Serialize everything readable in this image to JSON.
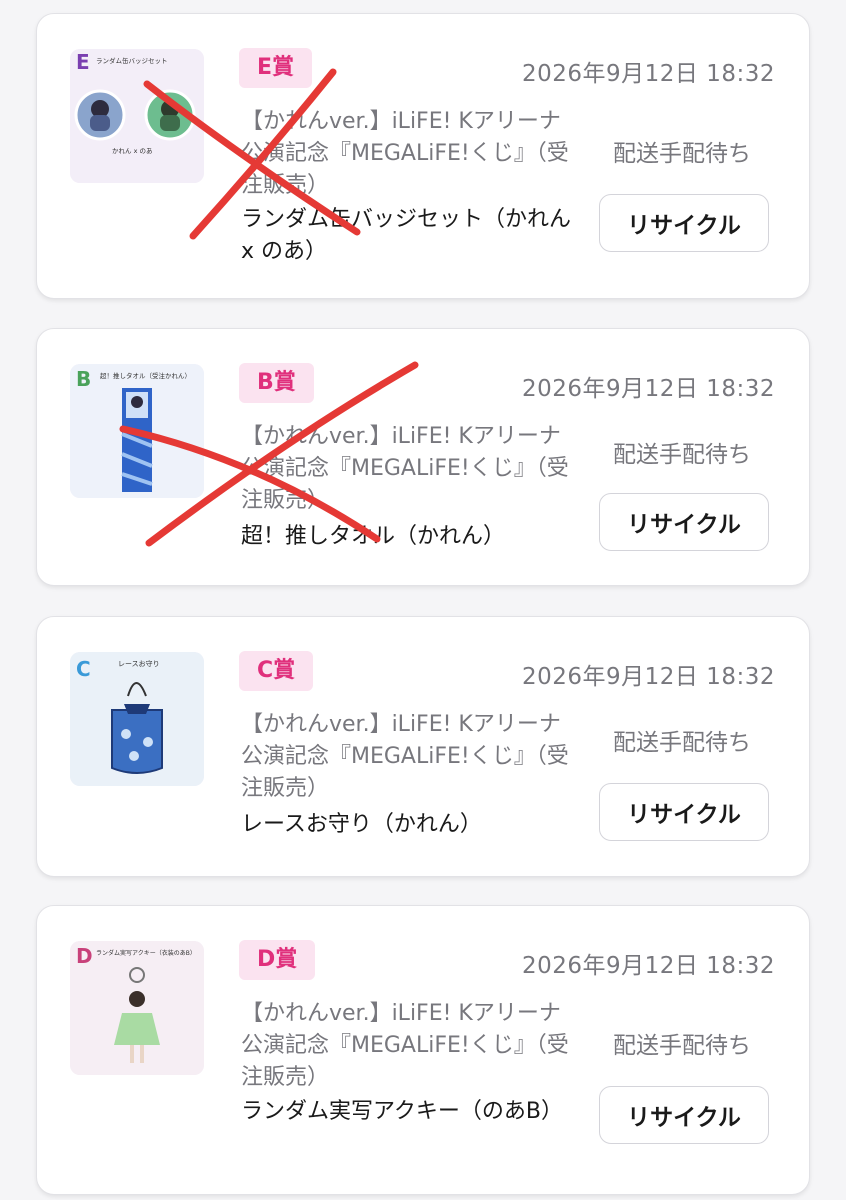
{
  "orders": [
    {
      "prize": "E賞",
      "date": "2026年9月12日 18:32",
      "description": "【かれんver.】iLiFE! Kアリーナ公演記念『MEGALiFE!くじ』（受注販売）",
      "item": "ランダム缶バッジセット（かれん x のあ）",
      "status": "配送手配待ち",
      "button": "リサイクル",
      "thumb": {
        "letter": "E",
        "caption": "ランダム缶バッジセット",
        "footer": "かれん x のあ",
        "accent": "#7a3fb0"
      },
      "crossed_out": true
    },
    {
      "prize": "B賞",
      "date": "2026年9月12日 18:32",
      "description": "【かれんver.】iLiFE! Kアリーナ公演記念『MEGALiFE!くじ』（受注販売）",
      "item": "超！推しタオル（かれん）",
      "status": "配送手配待ち",
      "button": "リサイクル",
      "thumb": {
        "letter": "B",
        "caption": "超！推しタオル（受注かれん）",
        "accent": "#4aa25a"
      },
      "crossed_out": true
    },
    {
      "prize": "C賞",
      "date": "2026年9月12日 18:32",
      "description": "【かれんver.】iLiFE! Kアリーナ公演記念『MEGALiFE!くじ』（受注販売）",
      "item": "レースお守り（かれん）",
      "status": "配送手配待ち",
      "button": "リサイクル",
      "thumb": {
        "letter": "C",
        "caption": "レースお守り",
        "accent": "#3a9ad8"
      },
      "crossed_out": false
    },
    {
      "prize": "D賞",
      "date": "2026年9月12日 18:32",
      "description": "【かれんver.】iLiFE! Kアリーナ公演記念『MEGALiFE!くじ』（受注販売）",
      "item": "ランダム実写アクキー（のあB）",
      "status": "配送手配待ち",
      "button": "リサイクル",
      "thumb": {
        "letter": "D",
        "caption": "ランダム実写アクキー（衣装のあB）",
        "accent": "#c8417a"
      },
      "crossed_out": false
    }
  ],
  "colors": {
    "badge_bg": "#fbe3f0",
    "badge_text": "#e0307c",
    "muted_text": "#77777d",
    "cross_mark": "#e53935"
  }
}
